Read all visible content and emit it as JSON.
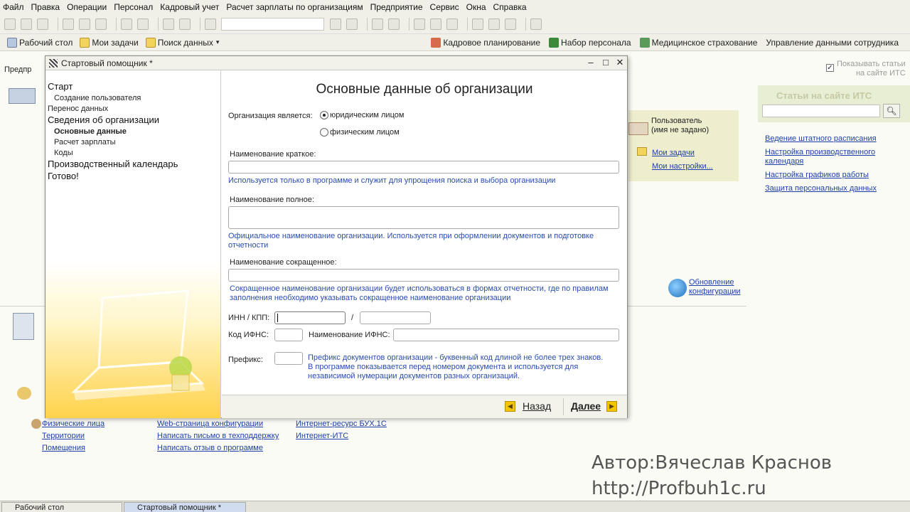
{
  "menu": [
    "Файл",
    "Правка",
    "Операции",
    "Персонал",
    "Кадровый учет",
    "Расчет зарплаты по организациям",
    "Предприятие",
    "Сервис",
    "Окна",
    "Справка"
  ],
  "toolbar2": {
    "left": [
      "Рабочий стол",
      "Мои задачи",
      "Поиск данных"
    ],
    "right": [
      "Кадровое планирование",
      "Набор персонала",
      "Медицинское страхование",
      "Управление данными сотрудника"
    ]
  },
  "background": {
    "left_tab": "Предпр",
    "user_name": "Пользователь",
    "user_sub": "(имя не задано)",
    "my_tasks": "Мои задачи",
    "my_settings": "Мои настройки...",
    "update_config": [
      "Обновление",
      "конфигурации"
    ],
    "its_title": "Статьи на сайте ИТС",
    "its_show": [
      "Показывать статьи",
      "на сайте ИТС"
    ],
    "its_links": [
      "Ведение штатного расписания",
      "Настройка производственного",
      "календаря",
      "Настройка графиков работы",
      "Защита персональных данных"
    ],
    "bottom_links": [
      "Физические лица",
      "Территории",
      "Помещения",
      "Web-страница конфигурации",
      "Написать письмо в техподдержку",
      "Написать отзыв о программе",
      "Интернет-ресурс БУХ.1С",
      "Интернет-ИТС"
    ]
  },
  "watermark": [
    "Автор:Вячеслав Краснов",
    "http://Profbuh1c.ru"
  ],
  "taskbar": [
    "Рабочий стол",
    "Стартовый помощник *"
  ],
  "dialog": {
    "title": "Стартовый помощник *",
    "nav": {
      "start": "Старт",
      "create_user": "Создание пользователя",
      "transfer": "Перенос данных",
      "org_info": "Сведения об организации",
      "basic_data": "Основные данные",
      "payroll": "Расчет зарплаты",
      "codes": "Коды",
      "calendar": "Производственный календарь",
      "done": "Готово!"
    },
    "heading": "Основные данные об организации",
    "org_type_label": "Организация является:",
    "org_type_legal": "юридическим лицом",
    "org_type_individual": "физическим лицом",
    "org_type_selected": "legal",
    "short_name_label": "Наименование краткое:",
    "short_name_value": "",
    "short_name_hint": "Используется только в программе и служит для упрощения поиска и выбора организации",
    "full_name_label": "Наименование полное:",
    "full_name_value": "",
    "full_name_hint": [
      "Официальное наименование организации. Используется при оформлении документов и подготовке",
      "отчетности"
    ],
    "abbr_name_label": "Наименование сокращенное:",
    "abbr_name_value": "",
    "abbr_name_hint": [
      "Сокращенное наименование организации будет использоваться в формах отчетности, где по правилам",
      "заполнения необходимо указывать сокращенное наименование организации"
    ],
    "inn_kpp_label": "ИНН / КПП:",
    "inn_value": "",
    "kpp_value": "",
    "slash": "/",
    "ifns_code_label": "Код ИФНС:",
    "ifns_name_label": "Наименование ИФНС:",
    "prefix_label": "Префикс:",
    "prefix_hint": [
      "Префикс документов организации - буквенный код длиной не более трех знаков.",
      "В программе показывается перед номером документа и используется для",
      "независимой нумерации документов разных организаций."
    ],
    "back_button": "Назад",
    "next_button": "Далее"
  },
  "colors": {
    "accent_yellow": "#f3c400",
    "link_blue": "#1e3fa8",
    "hint_blue": "#2a4cb0"
  }
}
